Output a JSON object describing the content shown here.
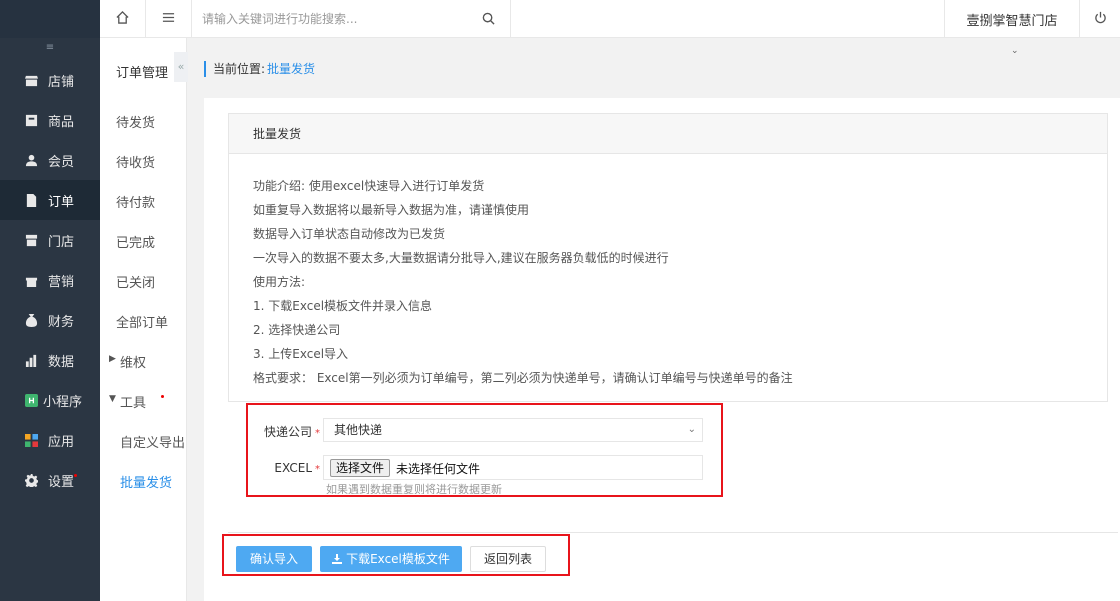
{
  "sidebar": {
    "items": [
      {
        "label": "店铺",
        "icon": "store-icon"
      },
      {
        "label": "商品",
        "icon": "goods-icon"
      },
      {
        "label": "会员",
        "icon": "member-icon"
      },
      {
        "label": "订单",
        "icon": "order-icon",
        "active": true
      },
      {
        "label": "门店",
        "icon": "shop-icon"
      },
      {
        "label": "营销",
        "icon": "gift-icon"
      },
      {
        "label": "财务",
        "icon": "money-bag-icon"
      },
      {
        "label": "数据",
        "icon": "bar-chart-icon"
      },
      {
        "label": "小程序",
        "icon": "mini-program-icon"
      },
      {
        "label": "应用",
        "icon": "apps-icon"
      },
      {
        "label": "设置",
        "icon": "gear-icon"
      }
    ]
  },
  "subnav": {
    "title": "订单管理",
    "collapse_glyph": "«",
    "items": [
      "待发货",
      "待收货",
      "待付款",
      "已完成",
      "已关闭",
      "全部订单",
      "维权",
      "工具",
      "自定义导出",
      "批量发货"
    ]
  },
  "topbar": {
    "search_placeholder": "请输入关键词进行功能搜索...",
    "store_name": "壹捌掌智慧门店"
  },
  "breadcrumb": {
    "label": "当前位置:",
    "current": "批量发货"
  },
  "card": {
    "title": "批量发货",
    "lines": [
      "功能介绍: 使用excel快速导入进行订单发货",
      "如重复导入数据将以最新导入数据为准，请谨慎使用",
      "数据导入订单状态自动修改为已发货",
      "一次导入的数据不要太多,大量数据请分批导入,建议在服务器负载低的时候进行",
      "使用方法:",
      "1. 下载Excel模板文件并录入信息",
      "2. 选择快递公司",
      "3. 上传Excel导入",
      "格式要求：  Excel第一列必须为订单编号，第二列必须为快递单号，请确认订单编号与快递单号的备注"
    ]
  },
  "form": {
    "express_label": "快递公司",
    "express_value": "其他快递",
    "excel_label": "EXCEL",
    "required_mark": "*",
    "file_button": "选择文件",
    "file_status": "未选择任何文件",
    "hint": "如果遇到数据重复则将进行数据更新"
  },
  "buttons": {
    "confirm": "确认导入",
    "download": "下载Excel模板文件",
    "back": "返回列表"
  },
  "colors": {
    "sidebar_bg": "#2b3643",
    "accent": "#2a8fe8",
    "primary_button": "#4ea9f2",
    "highlight_border": "#e8141b"
  }
}
